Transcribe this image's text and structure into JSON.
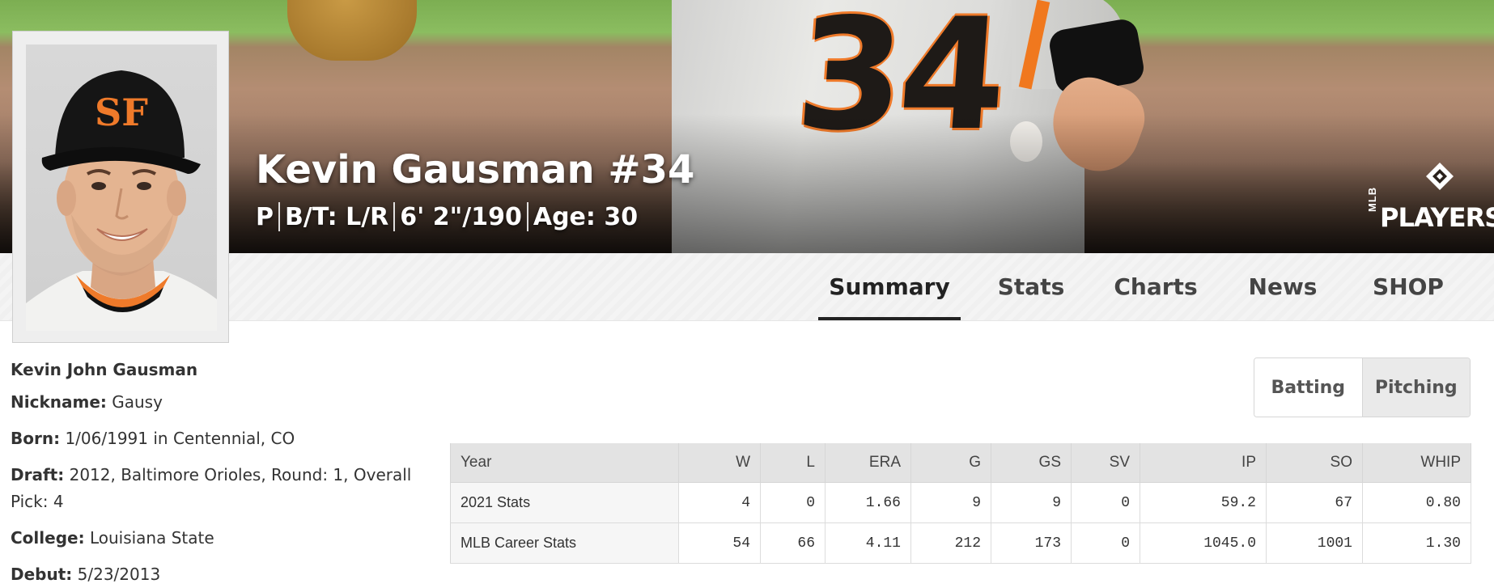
{
  "player": {
    "hero_name": "Kevin Gausman #34",
    "meta": [
      "P",
      "B/T: L/R",
      "6' 2\"/190",
      "Age: 30"
    ],
    "jersey_number": "34"
  },
  "logo": {
    "small": "MLB",
    "text": "PLAYERS"
  },
  "tabs": [
    {
      "label": "Summary",
      "active": true
    },
    {
      "label": "Stats",
      "active": false
    },
    {
      "label": "Charts",
      "active": false
    },
    {
      "label": "News",
      "active": false
    },
    {
      "label": "SHOP",
      "active": false
    }
  ],
  "bio": {
    "full_name": "Kevin John Gausman",
    "nickname_label": "Nickname:",
    "nickname": "Gausy",
    "born_label": "Born:",
    "born": "1/06/1991 in Centennial, CO",
    "draft_label": "Draft:",
    "draft": "2012, Baltimore Orioles, Round: 1, Overall Pick: 4",
    "college_label": "College:",
    "college": "Louisiana State",
    "debut_label": "Debut:",
    "debut": "5/23/2013"
  },
  "toggle": {
    "batting": "Batting",
    "pitching": "Pitching",
    "active": "pitching"
  },
  "stats_table": {
    "headers": [
      "Year",
      "W",
      "L",
      "ERA",
      "G",
      "GS",
      "SV",
      "IP",
      "SO",
      "WHIP"
    ],
    "rows": [
      [
        "2021 Stats",
        "4",
        "0",
        "1.66",
        "9",
        "9",
        "0",
        "59.2",
        "67",
        "0.80"
      ],
      [
        "MLB Career Stats",
        "54",
        "66",
        "4.11",
        "212",
        "173",
        "0",
        "1045.0",
        "1001",
        "1.30"
      ]
    ]
  },
  "colors": {
    "accent": "#222222",
    "team_orange": "#f0781e",
    "team_black": "#111111"
  }
}
